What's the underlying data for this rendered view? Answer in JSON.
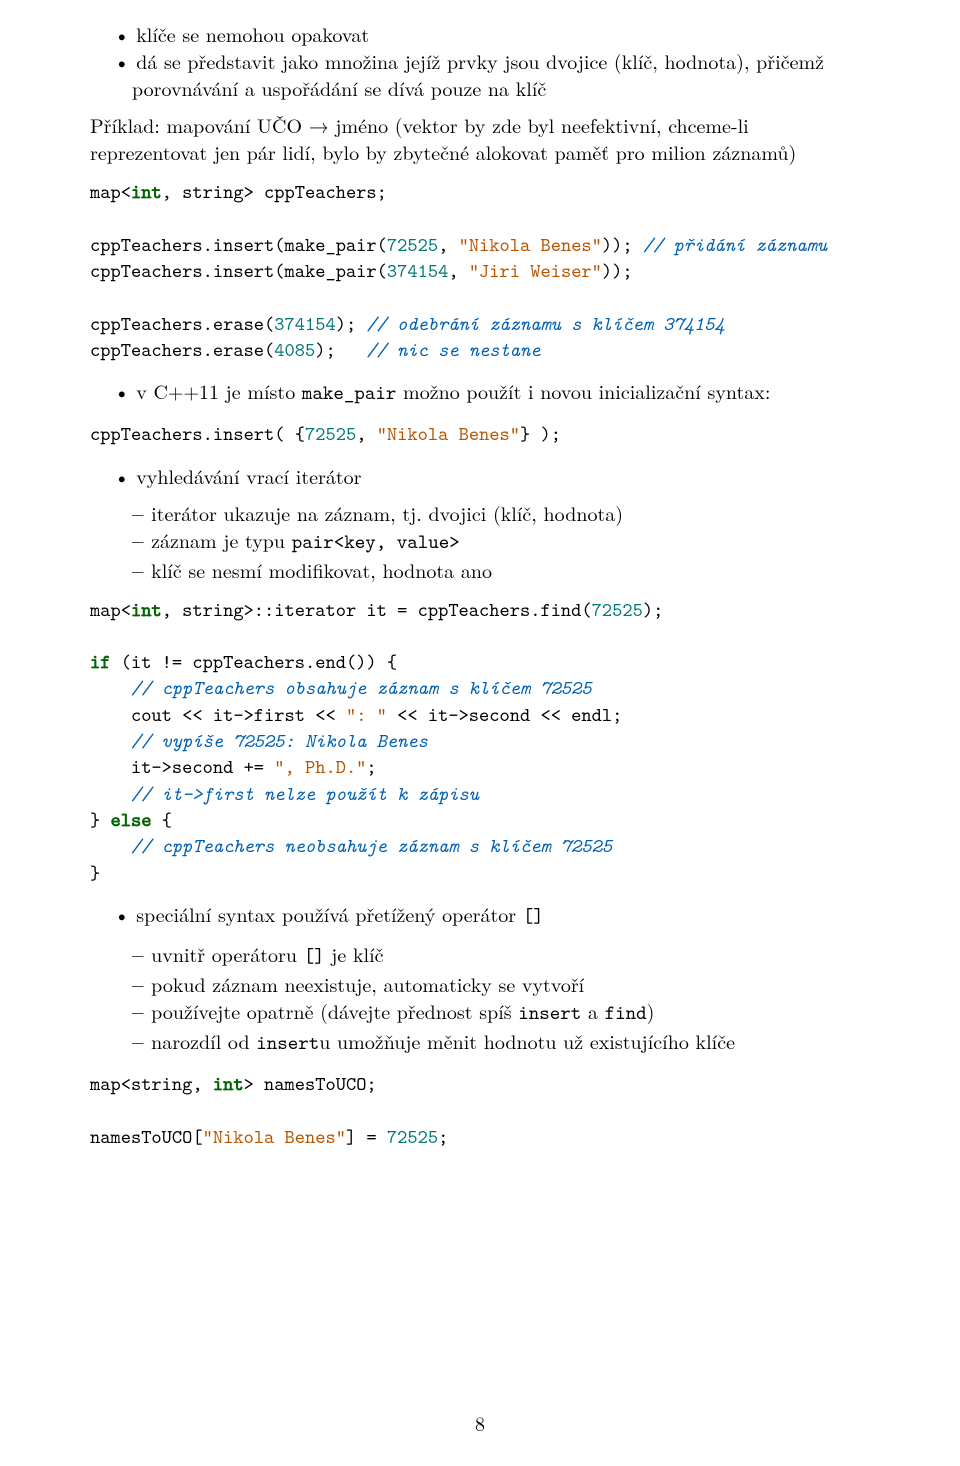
{
  "bullets1": {
    "a": "klíče se nemohou opakovat",
    "b": "dá se představit jako množina jejíž prvky jsou dvojice (klíč, hodnota), přičemž porovnávání a uspořádání se dívá pouze na klíč"
  },
  "para1_pre": "Příklad: mapování UČO → jméno (vektor by zde byl neefektivní, chceme-li reprezentovat jen pár lidí, bylo by zbytečné alokovat paměť pro milion záznamů)",
  "code1": {
    "l1_a": "map<",
    "l1_b": "int",
    "l1_c": ", string> cppTeachers;",
    "l3_a": "cppTeachers.insert(make_pair(",
    "l3_b": "72525",
    "l3_c": ", ",
    "l3_d": "\"Nikola Benes\"",
    "l3_e": ")); ",
    "l3_f": "// přidání záznamu",
    "l4_a": "cppTeachers.insert(make_pair(",
    "l4_b": "374154",
    "l4_c": ", ",
    "l4_d": "\"Jiri Weiser\"",
    "l4_e": "));",
    "l6_a": "cppTeachers.erase(",
    "l6_b": "374154",
    "l6_c": "); ",
    "l6_d": "// odebrání záznamu s klíčem 374154",
    "l7_a": "cppTeachers.erase(",
    "l7_b": "4085",
    "l7_c": ");   ",
    "l7_d": "// nic se nestane"
  },
  "bullets2": {
    "a_pre": "v C++11 je místo ",
    "a_code": "make_pair",
    "a_post": " možno použít i novou inicializační syntax:"
  },
  "code2": {
    "l1_a": "cppTeachers.insert( {",
    "l1_b": "72525",
    "l1_c": ", ",
    "l1_d": "\"Nikola Benes\"",
    "l1_e": "} );"
  },
  "bullets3": {
    "a": "vyhledávání vrací iterátor",
    "b": "iterátor ukazuje na záznam, tj. dvojici (klíč, hodnota)",
    "c_pre": "záznam je typu ",
    "c_code": "pair<key, value>",
    "d": "klíč se nesmí modifikovat, hodnota ano"
  },
  "code3": {
    "l1_a": "map<",
    "l1_b": "int",
    "l1_c": ", string>::iterator it = cppTeachers.find(",
    "l1_d": "72525",
    "l1_e": ");",
    "l3_a": "if",
    "l3_b": " (it != cppTeachers.end()) {",
    "l4": "    // cppTeachers obsahuje záznam s klíčem 72525",
    "l5_a": "    cout << it->first << ",
    "l5_b": "\": \"",
    "l5_c": " << it->second << endl;",
    "l6": "    // vypíše 72525: Nikola Benes",
    "l7_a": "    it->second += ",
    "l7_b": "\", Ph.D.\"",
    "l7_c": ";",
    "l8": "    // it->first nelze použít k zápisu",
    "l9_a": "} ",
    "l9_b": "else",
    "l9_c": " {",
    "l10": "    // cppTeachers neobsahuje záznam s klíčem 72525",
    "l11": "}"
  },
  "bullets4": {
    "a_pre": "speciální syntax používá přetížený operátor ",
    "a_code": "[]",
    "b_pre": "uvnitř operátoru ",
    "b_code": "[]",
    "b_post": " je klíč",
    "c": "pokud záznam neexistuje, automaticky se vytvoří",
    "d_pre": "používejte opatrně (dávejte přednost spíš ",
    "d_code1": "insert",
    "d_mid": " a ",
    "d_code2": "find",
    "d_post": ")",
    "e_pre": "narozdíl od ",
    "e_code": "insert",
    "e_post": "u umožňuje měnit hodnotu už existujícího klíče"
  },
  "code4": {
    "l1_a": "map<string, ",
    "l1_b": "int",
    "l1_c": "> namesToUCO;",
    "l3_a": "namesToUCO[",
    "l3_b": "\"Nikola Benes\"",
    "l3_c": "] = ",
    "l3_d": "72525",
    "l3_e": ";"
  },
  "pagenum": "8"
}
